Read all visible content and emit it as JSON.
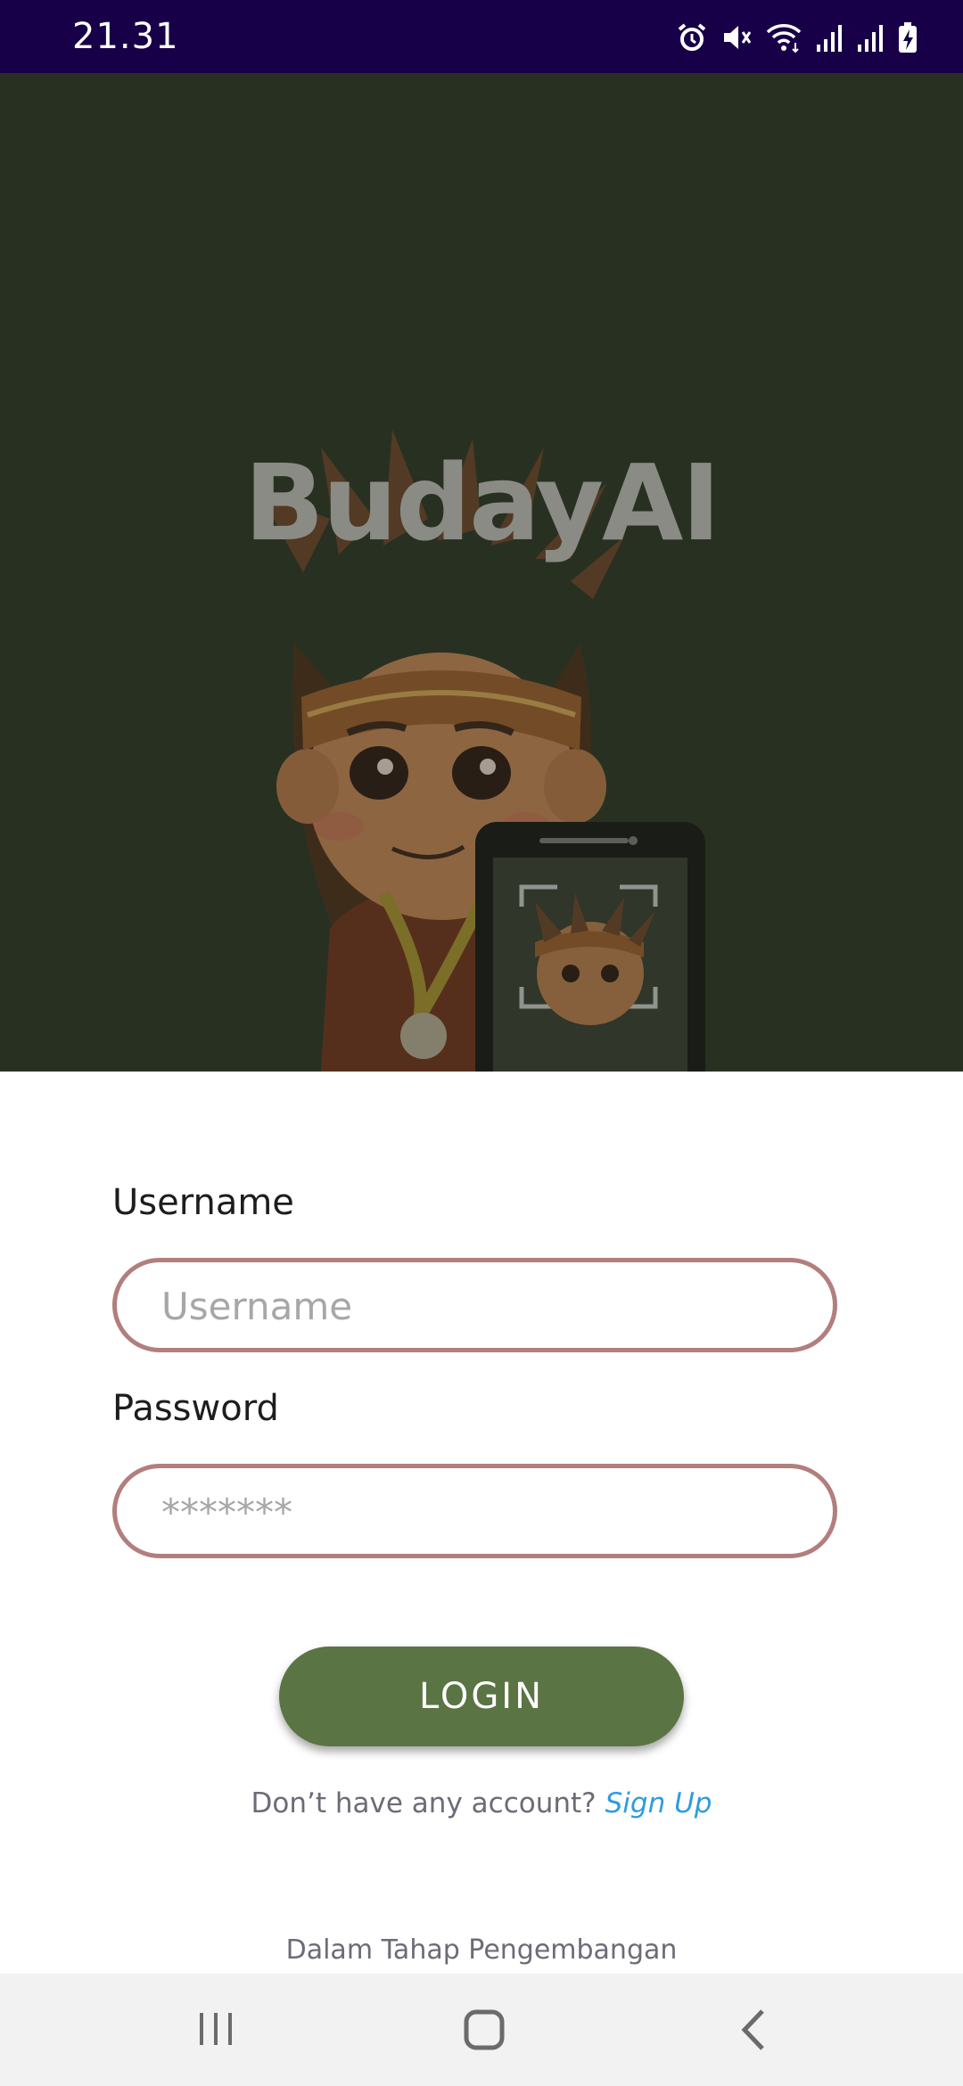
{
  "status_bar": {
    "time": "21.31",
    "icons": [
      "alarm-icon",
      "mute-icon",
      "wifi-icon",
      "signal-icon",
      "signal-icon",
      "battery-charging-icon"
    ]
  },
  "hero": {
    "title": "BudayAI",
    "background_color": "#283221"
  },
  "form": {
    "username_label": "Username",
    "username_placeholder": "Username",
    "password_label": "Password",
    "password_placeholder": "*******",
    "login_label": "LOGIN",
    "signup_prompt": "Don’t have any account?",
    "signup_link": "Sign Up",
    "dev_note": "Dalam Tahap Pengembangan",
    "accent_color": "#5a7443",
    "field_border_color": "#b27e7e",
    "link_color": "#2e9ce0"
  },
  "nav_bar": {
    "buttons": [
      "recent-apps-icon",
      "home-icon",
      "back-icon"
    ]
  }
}
